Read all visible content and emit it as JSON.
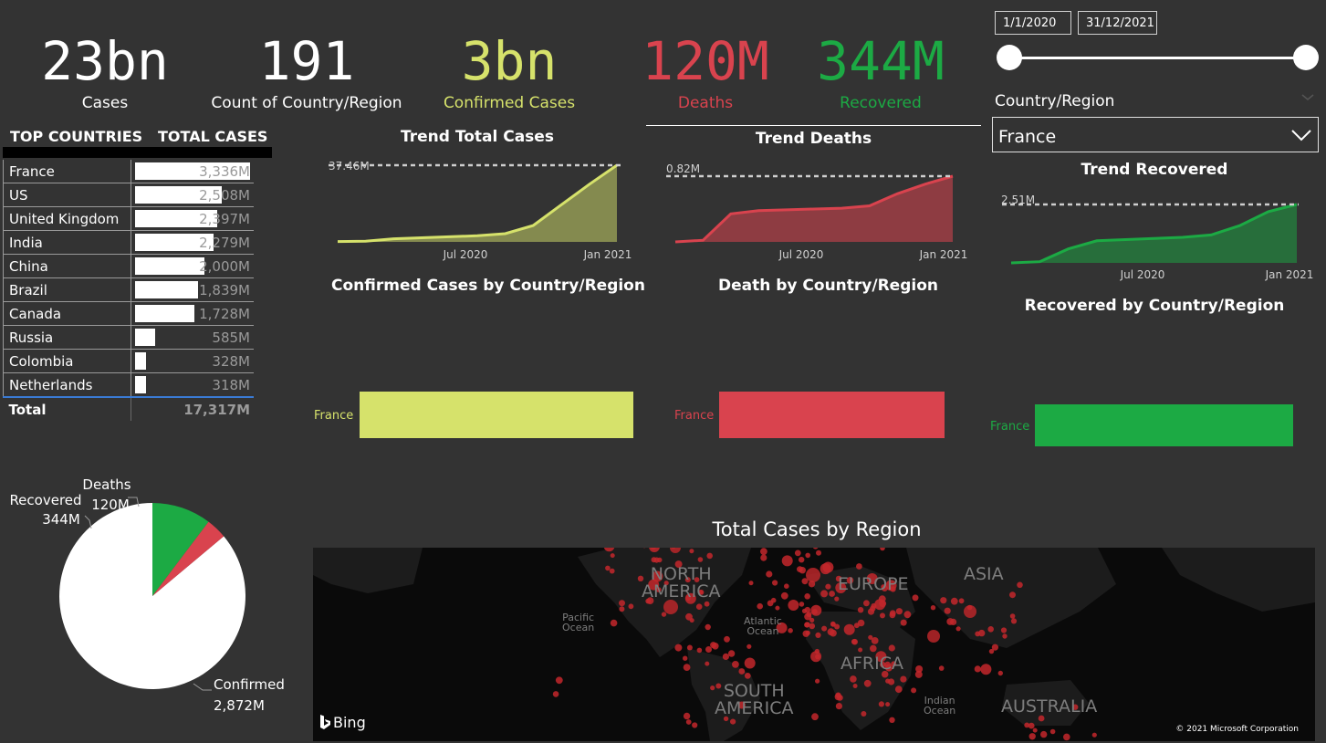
{
  "kpis": [
    {
      "value": "23bn",
      "label": "Cases",
      "color": "#ffffff"
    },
    {
      "value": "191",
      "label": "Count of Country/Region",
      "color": "#ffffff"
    },
    {
      "value": "3bn",
      "label": "Confirmed Cases",
      "color": "#d6e26b"
    },
    {
      "value": "120M",
      "label": "Deaths",
      "color": "#d9434e"
    },
    {
      "value": "344M",
      "label": "Recovered",
      "color": "#1caa44"
    }
  ],
  "date_range": {
    "start": "1/1/2020",
    "end": "31/12/2021"
  },
  "filter": {
    "label": "Country/Region",
    "selected": "France"
  },
  "top_table": {
    "headers": [
      "TOP COUNTRIES",
      "TOTAL CASES"
    ],
    "rows": [
      {
        "country": "France",
        "value": "3,336M",
        "fraction": 1.0
      },
      {
        "country": "US",
        "value": "2,508M",
        "fraction": 0.752
      },
      {
        "country": "United Kingdom",
        "value": "2,397M",
        "fraction": 0.718
      },
      {
        "country": "India",
        "value": "2,279M",
        "fraction": 0.683
      },
      {
        "country": "China",
        "value": "2,000M",
        "fraction": 0.6
      },
      {
        "country": "Brazil",
        "value": "1,839M",
        "fraction": 0.551
      },
      {
        "country": "Canada",
        "value": "1,728M",
        "fraction": 0.518
      },
      {
        "country": "Russia",
        "value": "585M",
        "fraction": 0.175
      },
      {
        "country": "Colombia",
        "value": "328M",
        "fraction": 0.098
      },
      {
        "country": "Netherlands",
        "value": "318M",
        "fraction": 0.095
      }
    ],
    "total_label": "Total",
    "total_value": "17,317M"
  },
  "trend_total": {
    "title": "Trend Total Cases",
    "peak_label": "37.46M",
    "x_ticks": [
      "Jul 2020",
      "Jan 2021"
    ]
  },
  "trend_deaths": {
    "title": "Trend Deaths",
    "peak_label": "0.82M",
    "x_ticks": [
      "Jul 2020",
      "Jan 2021"
    ]
  },
  "trend_recovered": {
    "title": "Trend Recovered",
    "peak_label": "2.51M",
    "x_ticks": [
      "Jul 2020",
      "Jan 2021"
    ]
  },
  "bar_confirmed": {
    "title": "Confirmed Cases by Country/Region",
    "category": "France"
  },
  "bar_deaths": {
    "title": "Death by Country/Region",
    "category": "France"
  },
  "bar_recovered": {
    "title": "Recovered by Country/Region",
    "category": "France"
  },
  "pie": {
    "slices": [
      {
        "name": "Confirmed",
        "value_label": "2,872M",
        "value": 2872,
        "color": "#ffffff"
      },
      {
        "name": "Recovered",
        "value_label": "344M",
        "value": 344,
        "color": "#1caa44"
      },
      {
        "name": "Deaths",
        "value_label": "120M",
        "value": 120,
        "color": "#d9434e"
      }
    ]
  },
  "map": {
    "title": "Total Cases by Region",
    "labels": {
      "north_america": "NORTH\nAMERICA",
      "europe": "EUROPE",
      "asia": "ASIA",
      "africa": "AFRICA",
      "south_america": "SOUTH\nAMERICA",
      "australia": "AUSTRALIA",
      "pacific": "Pacific\nOcean",
      "atlantic": "Atlantic\nOcean",
      "indian": "Indian\nOcean"
    },
    "bing": "Bing",
    "copyright": "© 2021 Microsoft Corporation"
  },
  "chart_data": [
    {
      "type": "line",
      "title": "Trend Total Cases",
      "x_ticks": [
        "Jul 2020",
        "Jan 2021"
      ],
      "series": [
        {
          "values": [
            0.2,
            0.3,
            1.5,
            2.0,
            2.5,
            3.0,
            4.0,
            8.0,
            18.0,
            28.0,
            37.46
          ]
        }
      ],
      "color": "#d6e26b"
    },
    {
      "type": "line",
      "title": "Trend Deaths",
      "x_ticks": [
        "Jul 2020",
        "Jan 2021"
      ],
      "series": [
        {
          "values": [
            0.0,
            0.02,
            0.35,
            0.39,
            0.4,
            0.41,
            0.42,
            0.45,
            0.6,
            0.72,
            0.82
          ]
        }
      ],
      "color": "#d9434e"
    },
    {
      "type": "line",
      "title": "Trend Recovered",
      "x_ticks": [
        "Jul 2020",
        "Jan 2021"
      ],
      "series": [
        {
          "values": [
            0.0,
            0.05,
            0.6,
            0.95,
            1.0,
            1.05,
            1.1,
            1.2,
            1.6,
            2.2,
            2.51
          ]
        }
      ],
      "color": "#1caa44"
    },
    {
      "type": "bar",
      "title": "Confirmed Cases by Country/Region",
      "categories": [
        "France"
      ],
      "values": [
        1
      ],
      "color": "#d6e26b"
    },
    {
      "type": "bar",
      "title": "Death by Country/Region",
      "categories": [
        "France"
      ],
      "values": [
        1
      ],
      "color": "#d9434e"
    },
    {
      "type": "bar",
      "title": "Recovered by Country/Region",
      "categories": [
        "France"
      ],
      "values": [
        1
      ],
      "color": "#1caa44"
    },
    {
      "type": "pie",
      "categories": [
        "Confirmed",
        "Recovered",
        "Deaths"
      ],
      "values": [
        2872,
        344,
        120
      ]
    }
  ]
}
